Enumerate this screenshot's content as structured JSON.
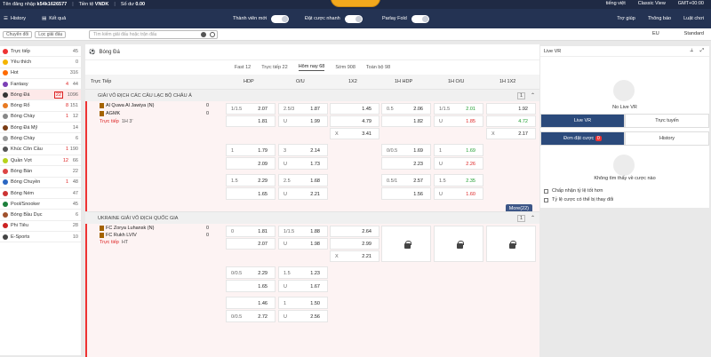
{
  "topbar": {
    "login": "Tên đăng nhập",
    "user": "k54k1626577",
    "currency_label": "Tiền tệ",
    "currency": "VNDK",
    "balance_label": "Số dư",
    "balance": "0.00",
    "lang": "tiếng việt",
    "view": "Classic View",
    "tz": "GMT+00:00"
  },
  "nav": {
    "history": "History",
    "results": "Kết quả",
    "new_member": "Thành viên mới",
    "quick_bet": "Đặt cược nhanh",
    "parlay": "Parlay Fold",
    "help": "Trợ giúp",
    "notice": "Thông báo",
    "rules": "Luật chơi"
  },
  "filter": {
    "switch": "Chuyển đổi",
    "league_filter": "Lọc giải đấu",
    "search_placeholder": "Tìm kiếm giải đấu hoặc trận đấu",
    "odds_type": "EU",
    "mode": "Standard"
  },
  "sidebar": [
    {
      "label": "Trực tiếp",
      "c1": "",
      "c2": "45",
      "color": "#e33"
    },
    {
      "label": "Yêu thích",
      "c1": "",
      "c2": "0",
      "color": "#f4b400"
    },
    {
      "label": "Hot",
      "c1": "",
      "c2": "316",
      "color": "#ff6a00"
    },
    {
      "label": "Fantasy",
      "c1": "4",
      "c2": "44",
      "color": "#7b3fb6"
    },
    {
      "label": "Bóng Đá",
      "c1": "22",
      "c2": "1096",
      "color": "#333",
      "active": true
    },
    {
      "label": "Bóng Rổ",
      "c1": "8",
      "c2": "151",
      "color": "#e87a22"
    },
    {
      "label": "Bóng Chày",
      "c1": "1",
      "c2": "12",
      "color": "#888"
    },
    {
      "label": "Bóng Đá Mỹ",
      "c1": "",
      "c2": "14",
      "color": "#7a3c14"
    },
    {
      "label": "Bóng Chày",
      "c1": "",
      "c2": "6",
      "color": "#999"
    },
    {
      "label": "Khúc Côn Cầu",
      "c1": "1",
      "c2": "190",
      "color": "#555"
    },
    {
      "label": "Quần Vợt",
      "c1": "12",
      "c2": "66",
      "color": "#b7d31c"
    },
    {
      "label": "Bóng Bàn",
      "c1": "",
      "c2": "22",
      "color": "#d44"
    },
    {
      "label": "Bóng Chuyền",
      "c1": "1",
      "c2": "48",
      "color": "#2a66c2"
    },
    {
      "label": "Bóng Ném",
      "c1": "",
      "c2": "47",
      "color": "#c33"
    },
    {
      "label": "Pool/Snooker",
      "c1": "",
      "c2": "45",
      "color": "#1c7f3b"
    },
    {
      "label": "Bóng Bầu Dục",
      "c1": "",
      "c2": "6",
      "color": "#a0522d"
    },
    {
      "label": "Phi Tiêu",
      "c1": "",
      "c2": "28",
      "color": "#c22"
    },
    {
      "label": "E-Sports",
      "c1": "",
      "c2": "10",
      "color": "#444"
    }
  ],
  "main": {
    "sport": "Bóng Đá",
    "tabs": [
      "Fast 12",
      "Trực tiếp 22",
      "Hôm nay 68",
      "Sớm 908",
      "Toàn bộ 98"
    ],
    "cols": [
      "Trực Tiếp",
      "HDP",
      "O/U",
      "1X2",
      "1H HDP",
      "1H O/U",
      "1H 1X2"
    ],
    "league1": {
      "name": "GIẢI VÔ ĐỊCH CÁC CÂU LẠC BỘ CHÂU Á",
      "num": "1"
    },
    "m1": {
      "home": "Al Quwa Al Jawiya (N)",
      "away": "AGMK",
      "status": "Trực tiếp",
      "time": "1H 3'",
      "sh": "0",
      "sa": "0"
    },
    "rows1": [
      [
        "1/1.5",
        "2.07",
        "2.5/3",
        "1.87",
        "",
        "1.45",
        "0.5",
        "2.06",
        "1/1.5",
        "2.01",
        "",
        "1.92"
      ],
      [
        "",
        "1.81",
        "U",
        "1.99",
        "",
        "4.79",
        "",
        "1.82",
        "U",
        "1.85",
        "",
        "4.72"
      ],
      [
        "",
        "",
        "",
        "",
        "X",
        "3.41",
        "",
        "",
        "",
        "",
        "X",
        "2.17"
      ]
    ],
    "rows2": [
      [
        "1",
        "1.79",
        "3",
        "2.14",
        "0/0.5",
        "1.69",
        "1",
        "1.69"
      ],
      [
        "",
        "2.09",
        "U",
        "1.73",
        "",
        "2.23",
        "U",
        "2.26"
      ]
    ],
    "rows3": [
      [
        "1.5",
        "2.29",
        "2.5",
        "1.68",
        "0.5/1",
        "2.57",
        "1.5",
        "2.35"
      ],
      [
        "",
        "1.65",
        "U",
        "2.21",
        "",
        "1.56",
        "U",
        "1.60"
      ]
    ],
    "more": "More(22)",
    "league2": {
      "name": "UKRAINE GIẢI VÔ ĐỊCH QUỐC GIA",
      "num": "1"
    },
    "m2": {
      "home": "FC Zorya Luhansk (N)",
      "away": "FC Rukh LVIV",
      "status": "Trực tiếp",
      "time": "HT",
      "sh": "0",
      "sa": "0"
    },
    "rows4": [
      [
        "0",
        "1.81",
        "1/1.5",
        "1.88",
        "",
        "2.64"
      ],
      [
        "",
        "2.07",
        "U",
        "1.98",
        "",
        "2.99"
      ],
      [
        "",
        "",
        "",
        "",
        "X",
        "2.21"
      ]
    ],
    "rows5": [
      [
        "0/0.5",
        "2.29",
        "1.5",
        "1.23"
      ],
      [
        "",
        "1.65",
        "U",
        "1.67"
      ]
    ],
    "rows6": [
      [
        "",
        "1.46",
        "1",
        "1.50"
      ],
      [
        "0/0.5",
        "2.72",
        "U",
        "2.56"
      ]
    ]
  },
  "right": {
    "live_vr": "Live VR",
    "no_live": "No Live VR",
    "tab_live": "Live VR",
    "tab_online": "Trực tuyến",
    "tab_bets": "Đơn đặt cược",
    "bets_count": "0",
    "tab_history": "History",
    "empty_text": "Không tìm thấy về cược nào",
    "opt1": "Chấp nhận tỷ lệ tốt hơn",
    "opt2": "Tỷ lệ cược có thể bị thay đổi"
  }
}
